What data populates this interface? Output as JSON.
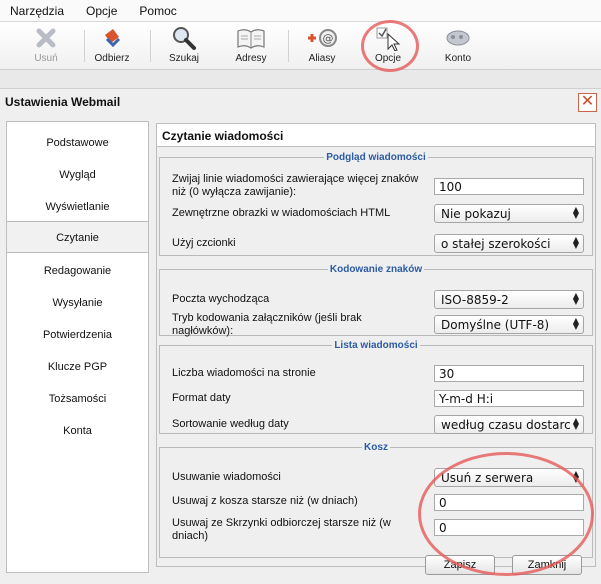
{
  "menu": [
    "Narzędzia",
    "Opcje",
    "Pomoc"
  ],
  "toolbar": {
    "delete": "Usuń",
    "receive": "Odbierz",
    "search": "Szukaj",
    "addresses": "Adresy",
    "aliases": "Aliasy",
    "options": "Opcje",
    "account": "Konto"
  },
  "dialog": {
    "title": "Ustawienia Webmail",
    "close_glyph": "✕",
    "sidebar": [
      "Podstawowe",
      "Wygląd",
      "Wyświetlanie",
      "Czytanie",
      "Redagowanie",
      "Wysyłanie",
      "Potwierdzenia",
      "Klucze PGP",
      "Tożsamości",
      "Konta"
    ],
    "active_index": 3,
    "pane_title": "Czytanie wiadomości",
    "sections": {
      "preview": {
        "legend": "Podgląd wiadomości",
        "wrap_label": "Zwijaj linie wiadomości zawierające więcej znaków niż (0 wyłącza zawijanie):",
        "wrap_value": "100",
        "images_label": "Zewnętrzne obrazki w wiadomościach HTML",
        "images_value": "Nie pokazuj",
        "font_label": "Użyj czcionki",
        "font_value": "o stałej szerokości"
      },
      "encoding": {
        "legend": "Kodowanie znaków",
        "outgoing_label": "Poczta wychodząca",
        "outgoing_value": "ISO-8859-2",
        "attach_label": "Tryb kodowania załączników (jeśli brak nagłówków):",
        "attach_value": "Domyślne (UTF-8)"
      },
      "list": {
        "legend": "Lista wiadomości",
        "per_page_label": "Liczba wiadomości na stronie",
        "per_page_value": "30",
        "date_label": "Format daty",
        "date_value": "Y-m-d H:i",
        "sort_label": "Sortowanie według daty",
        "sort_value": "według czasu dostarc"
      },
      "trash": {
        "legend": "Kosz",
        "delete_label": "Usuwanie wiadomości",
        "delete_value": "Usuń z serwera",
        "trash_days_label": "Usuwaj z kosza starsze niż (w dniach)",
        "trash_days_value": "0",
        "inbox_days_label": "Usuwaj ze Skrzynki odbiorczej starsze niż (w dniach)",
        "inbox_days_value": "0"
      }
    },
    "save": "Zapisz",
    "close": "Zamknij"
  }
}
